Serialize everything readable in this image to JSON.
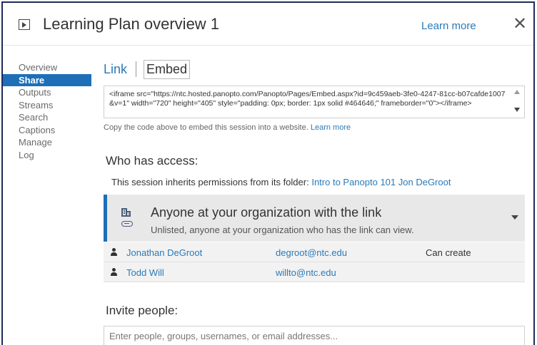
{
  "header": {
    "icon": "play-box-icon",
    "title": "Learning Plan overview 1",
    "learn_more": "Learn more",
    "close": "✕"
  },
  "sidebar": {
    "items": [
      {
        "label": "Overview",
        "active": false
      },
      {
        "label": "Share",
        "active": true
      },
      {
        "label": "Outputs",
        "active": false
      },
      {
        "label": "Streams",
        "active": false
      },
      {
        "label": "Search",
        "active": false
      },
      {
        "label": "Captions",
        "active": false
      },
      {
        "label": "Manage",
        "active": false
      },
      {
        "label": "Log",
        "active": false
      }
    ]
  },
  "share": {
    "tabs": {
      "link": "Link",
      "embed": "Embed"
    },
    "embed_code": "<iframe src=\"https://ntc.hosted.panopto.com/Panopto/Pages/Embed.aspx?id=9c459aeb-3fe0-4247-81cc-b07cafde1007&v=1\" width=\"720\" height=\"405\" style=\"padding: 0px; border: 1px solid #464646;\" frameborder=\"0\"></iframe>",
    "hint_text": "Copy the code above to embed this session into a website.",
    "hint_link": "Learn more"
  },
  "access": {
    "title": "Who has access:",
    "inherit_text": "This session inherits permissions from its folder:",
    "inherit_folder": "Intro to Panopto 101 Jon DeGroot",
    "permission": {
      "title": "Anyone at your organization with the link",
      "subtitle": "Unlisted, anyone at your organization who has the link can view."
    },
    "people": [
      {
        "name": "Jonathan DeGroot",
        "email": "degroot@ntc.edu",
        "role": "Can create"
      },
      {
        "name": "Todd Will",
        "email": "willto@ntc.edu",
        "role": ""
      }
    ]
  },
  "invite": {
    "title": "Invite people:",
    "placeholder": "Enter people, groups, usernames, or email addresses..."
  },
  "colors": {
    "accent": "#1e6fb8",
    "link": "#2a7ab8",
    "frame_border": "#1f2a5c",
    "panel_bg": "#e8e8e8"
  }
}
